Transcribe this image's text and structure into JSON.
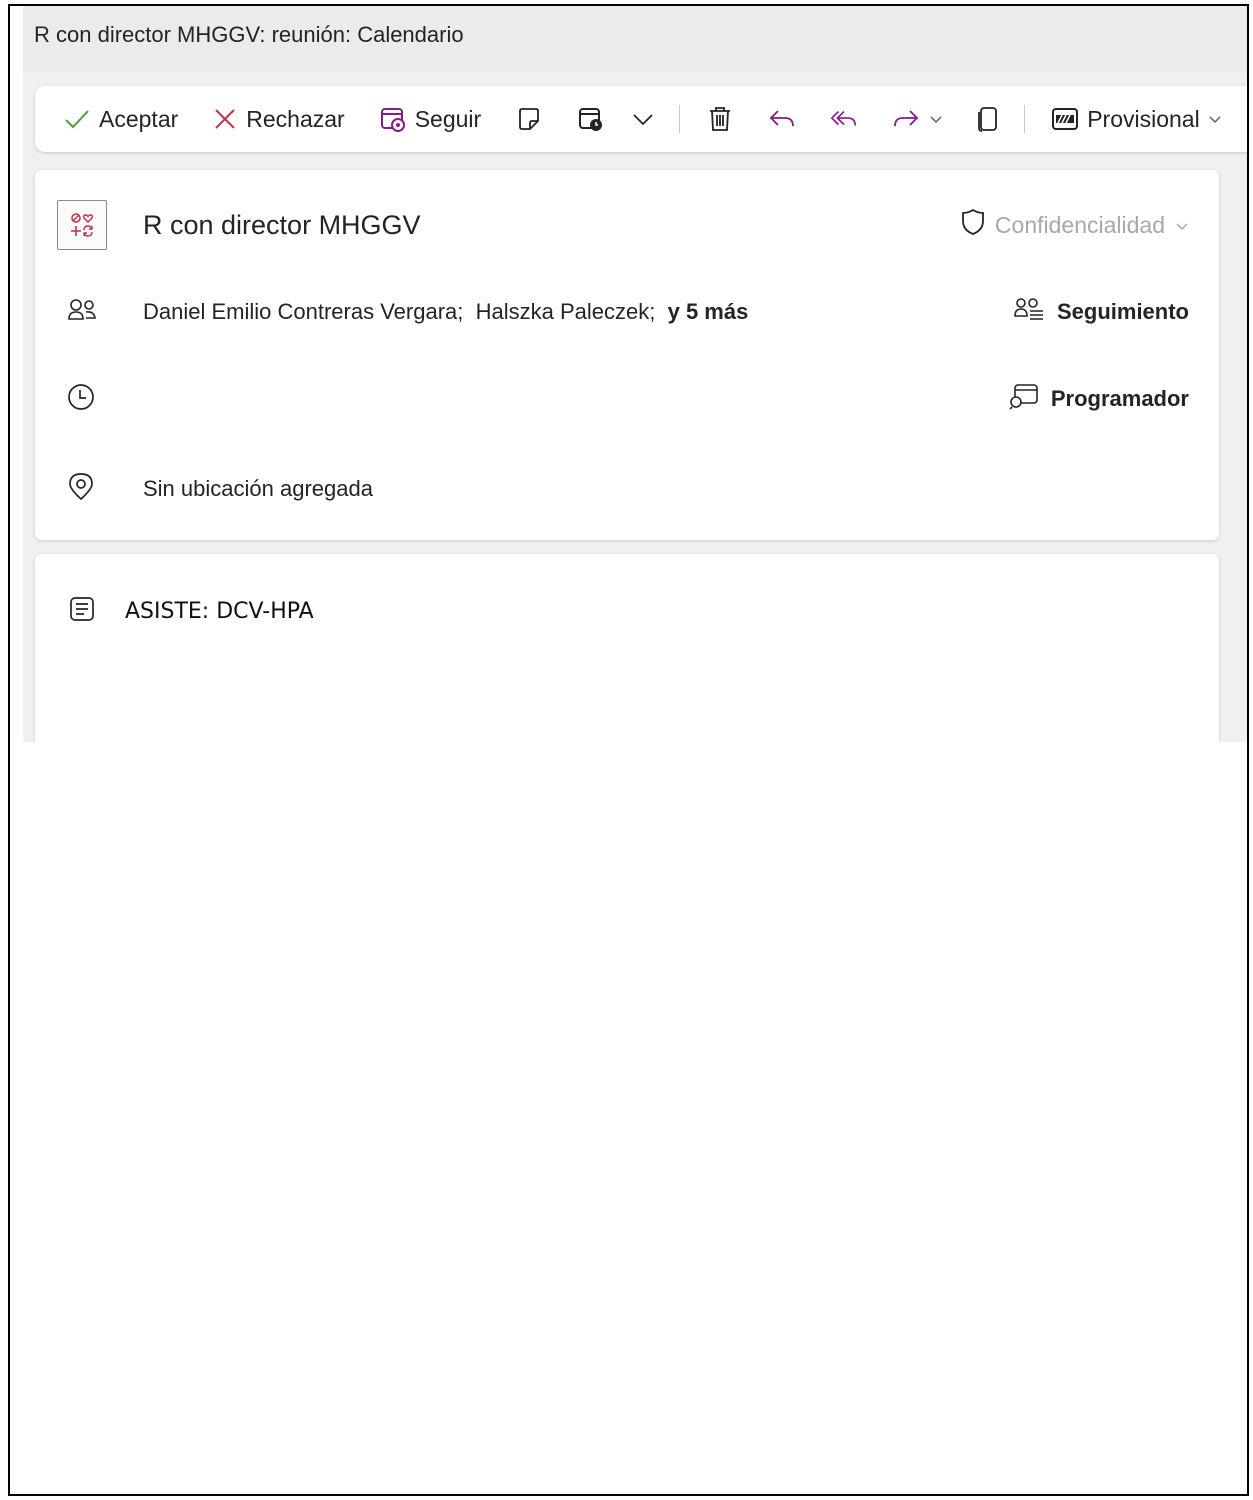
{
  "window": {
    "title": "R con director MHGGV: reunión: Calendario"
  },
  "toolbar": {
    "accept_label": "Aceptar",
    "decline_label": "Rechazar",
    "follow_label": "Seguir",
    "status_label": "Provisional",
    "accent_purple": "#8a1a8a",
    "accept_color": "#4f9a3b",
    "decline_color": "#c4314b"
  },
  "event": {
    "subject": "R con director MHGGV",
    "sensitivity_label": "Confidencialidad",
    "attendee_1": "Daniel Emilio Contreras Vergara;",
    "attendee_2": "Halszka Paleczek;",
    "more_attendees": "y 5 más",
    "tracking_label": "Seguimiento",
    "scheduler_label": "Programador",
    "location": "Sin ubicación agregada"
  },
  "body": {
    "text": "ASISTE: DCV-HPA"
  }
}
